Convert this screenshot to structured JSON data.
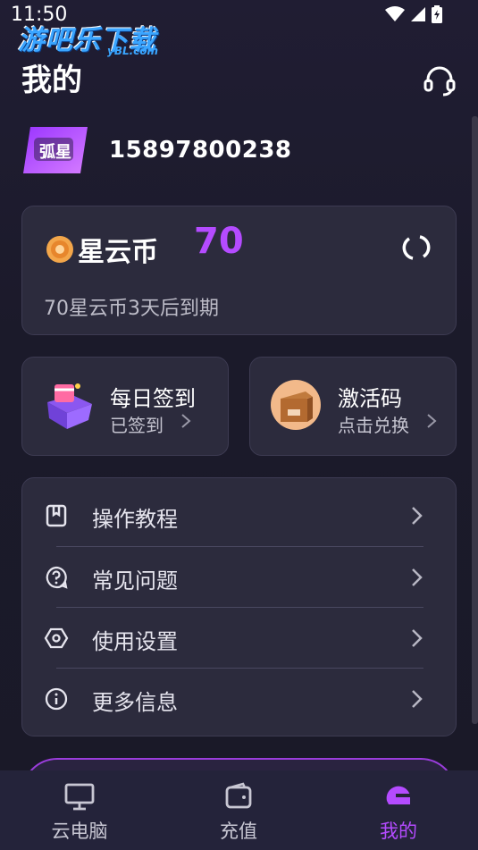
{
  "status_bar": {
    "time": "11:50"
  },
  "watermark": {
    "brand": "游吧乐下载",
    "domain": "yBL.com"
  },
  "header": {
    "title": "我的",
    "support_icon": "headset-icon"
  },
  "profile": {
    "logo_text": "弧星",
    "phone": "15897800238"
  },
  "coin_card": {
    "label": "星云币",
    "amount": "70",
    "expire_text": "70星云币3天后到期",
    "refresh_icon": "refresh-icon"
  },
  "checkin": {
    "title": "每日签到",
    "status": "已签到"
  },
  "activation": {
    "title": "激活码",
    "action": "点击兑换"
  },
  "menu": {
    "items": [
      {
        "label": "操作教程",
        "icon": "book-icon"
      },
      {
        "label": "常见问题",
        "icon": "question-icon"
      },
      {
        "label": "使用设置",
        "icon": "hexagon-settings-icon"
      },
      {
        "label": "更多信息",
        "icon": "info-icon"
      }
    ]
  },
  "bottom_nav": {
    "items": [
      {
        "label": "云电脑",
        "icon": "monitor-icon"
      },
      {
        "label": "充值",
        "icon": "wallet-icon"
      },
      {
        "label": "我的",
        "icon": "helmet-icon"
      }
    ],
    "active_index": 2
  },
  "colors": {
    "accent": "#b44bff",
    "background": "#1c1a2b",
    "card": "#2c2b3d",
    "nav_background": "#24233a"
  }
}
